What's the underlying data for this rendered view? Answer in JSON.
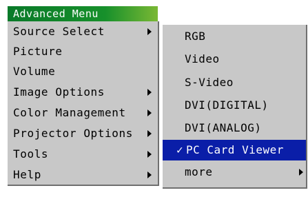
{
  "menu": {
    "title": "Advanced Menu",
    "items": [
      {
        "label": "Source Select",
        "has_submenu": true
      },
      {
        "label": "Picture",
        "has_submenu": false
      },
      {
        "label": "Volume",
        "has_submenu": false
      },
      {
        "label": "Image Options",
        "has_submenu": true
      },
      {
        "label": "Color Management",
        "has_submenu": true
      },
      {
        "label": "Projector Options",
        "has_submenu": true
      },
      {
        "label": "Tools",
        "has_submenu": true
      },
      {
        "label": "Help",
        "has_submenu": true
      }
    ]
  },
  "submenu": {
    "items": [
      {
        "label": "RGB"
      },
      {
        "label": "Video"
      },
      {
        "label": "S-Video"
      },
      {
        "label": "DVI(DIGITAL)"
      },
      {
        "label": "DVI(ANALOG)"
      },
      {
        "label": "PC Card Viewer",
        "selected": true
      },
      {
        "label": "more",
        "has_submenu": true
      }
    ],
    "checkmark": "✓"
  },
  "colors": {
    "menu_background": "#c8c8c8",
    "title_green": "#17902b",
    "selection_blue": "#0a1ea8"
  }
}
